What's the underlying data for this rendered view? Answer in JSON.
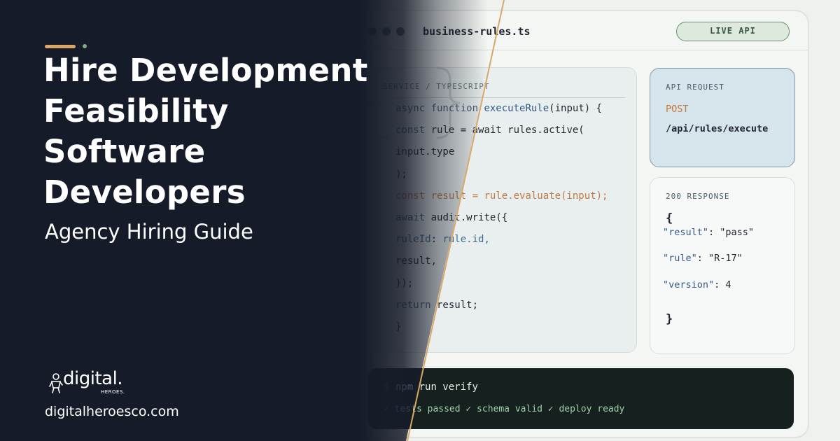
{
  "hero": {
    "title_lines": [
      "Hire Development",
      "Feasibility",
      "Software",
      "Developers"
    ],
    "subtitle": "Agency Hiring Guide"
  },
  "brand": {
    "logo_word": "digital.",
    "logo_sub": "HEROES.",
    "website": "digitalheroesco.com"
  },
  "editor": {
    "filename": "business-rules.ts",
    "status_pill": "LIVE API",
    "code_panel_label": "SERVICE / TYPESCRIPT",
    "code_lines": [
      "async function executeRule(input) {",
      "const rule = await rules.active(",
      "input.type",
      ");",
      "const result = rule.evaluate(input);",
      "await audit.write({",
      "ruleId: rule.id,",
      "result,",
      "});",
      "return result;",
      "}"
    ]
  },
  "api_request": {
    "label": "API REQUEST",
    "method": "POST",
    "path": "/api/rules/execute"
  },
  "api_response": {
    "label": "200 RESPONSE",
    "open_brace": "{",
    "close_brace": "}",
    "fields": [
      {
        "key": "\"result\"",
        "sep": ": ",
        "value": "\"pass\""
      },
      {
        "key": "\"rule\"",
        "sep": ": ",
        "value": "\"R-17\""
      },
      {
        "key": "\"version\"",
        "sep": ": ",
        "value": "4"
      }
    ]
  },
  "terminal": {
    "prompt": "$",
    "command": "npm run verify",
    "output": "✓ tests passed ✓ schema valid ✓ deploy ready"
  },
  "colors": {
    "left_background": "#161b29",
    "accent_gold": "#d9a867",
    "accent_green": "#7fae86",
    "terminal_background": "#15201f",
    "request_panel": "#d6e4ec"
  },
  "icons": {
    "window_controls": "three-dot-window-controls",
    "code_brace_watermark": "curly-brace-icon",
    "logo_mark": "hero-figure-icon"
  }
}
